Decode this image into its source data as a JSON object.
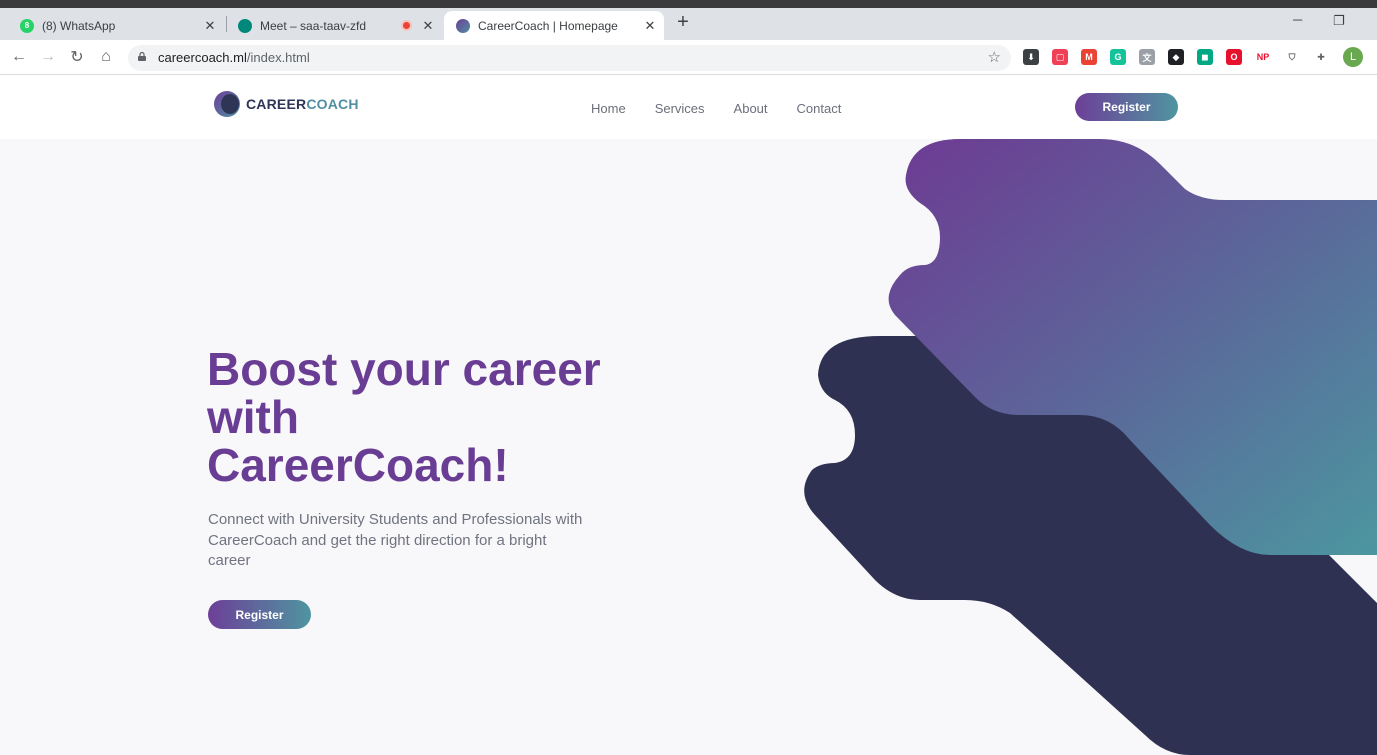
{
  "browser": {
    "tabs": [
      {
        "title": "(8) WhatsApp",
        "favicon": "whatsapp-icon",
        "favicon_color": "#25d366",
        "badge": "8"
      },
      {
        "title": "Meet – saa-taav-zfd",
        "favicon": "meet-icon",
        "favicon_color": "#00897b",
        "recording": true
      },
      {
        "title": "CareerCoach | Homepage",
        "favicon": "careercoach-icon",
        "favicon_color": "#4f8fa0",
        "active": true
      }
    ],
    "new_tab_glyph": "+",
    "close_glyph": "✕",
    "url_host": "careercoach.ml",
    "url_path": "/index.html",
    "profile_initial": "L",
    "extensions": [
      {
        "name": "download-ext-icon",
        "color": "#3c4043",
        "glyph": "⬇"
      },
      {
        "name": "pocket-ext-icon",
        "color": "#ef4056",
        "glyph": "▢"
      },
      {
        "name": "gmail-ext-icon",
        "color": "#ea4335",
        "glyph": "M"
      },
      {
        "name": "grammarly-ext-icon",
        "color": "#15c39a",
        "glyph": "G"
      },
      {
        "name": "translate-ext-icon",
        "color": "#9aa0a6",
        "glyph": "文"
      },
      {
        "name": "shield-badge-ext-icon",
        "color": "#202124",
        "glyph": "◆"
      },
      {
        "name": "meet-ext-icon",
        "color": "#00a884",
        "glyph": "◼"
      },
      {
        "name": "opera-ext-icon",
        "color": "#e8112d",
        "glyph": "O"
      },
      {
        "name": "np-ext-icon",
        "color": "#e8112d",
        "glyph": "NP"
      },
      {
        "name": "privacy-ext-icon",
        "color": "#5f6368",
        "glyph": "⛉"
      },
      {
        "name": "puzzle-ext-icon",
        "color": "#5f6368",
        "glyph": "✚"
      }
    ]
  },
  "site": {
    "logo": {
      "part1": "CAREER",
      "part2": "COACH"
    },
    "nav": [
      "Home",
      "Services",
      "About",
      "Contact"
    ],
    "header_button": "Register",
    "hero": {
      "title": "Boost your career with CareerCoach!",
      "subtitle": "Connect with University Students and Professionals with CareerCoach and get the right direction for a bright career",
      "button": "Register"
    },
    "colors": {
      "purple": "#6a3d94",
      "teal": "#4f95a0",
      "navy": "#2f3556",
      "background": "#f8f7f9"
    }
  }
}
